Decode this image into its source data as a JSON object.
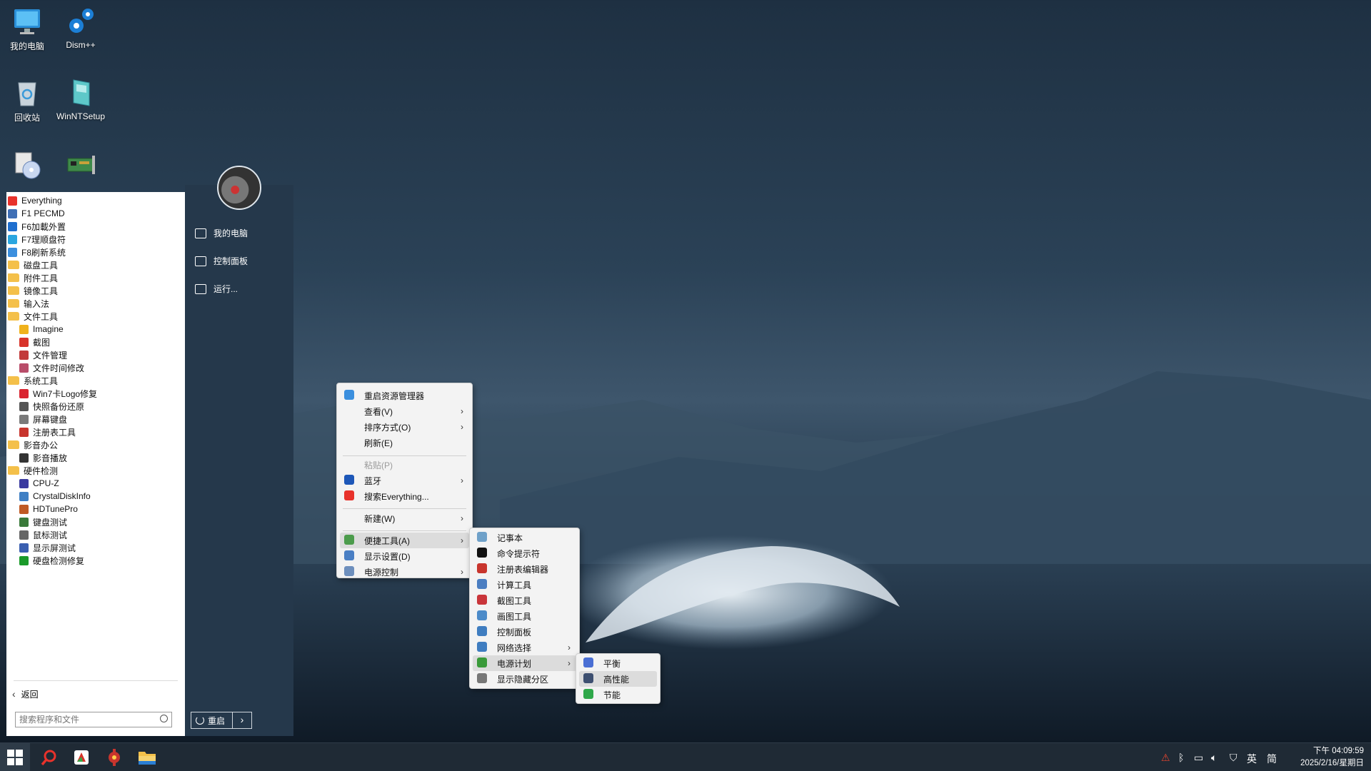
{
  "desktop": {
    "icons": [
      {
        "label": "我的电脑",
        "icon": "computer-icon"
      },
      {
        "label": "Dism++",
        "icon": "gears-icon"
      },
      {
        "label": "回收站",
        "icon": "recycle-bin-icon"
      },
      {
        "label": "WinNTSetup",
        "icon": "winntsetup-icon"
      },
      {
        "label": "",
        "icon": "installer-disc-icon"
      },
      {
        "label": "",
        "icon": "network-card-icon"
      }
    ]
  },
  "start_menu": {
    "items": [
      {
        "label": "Everything",
        "icon": "search-icon",
        "indent": false
      },
      {
        "label": "F1 PECMD",
        "icon": "pecmd-icon",
        "indent": false
      },
      {
        "label": "F6加載外置",
        "icon": "info-icon",
        "indent": false
      },
      {
        "label": "F7理顺盘符",
        "icon": "cube-icon",
        "indent": false
      },
      {
        "label": "F8刷新系统",
        "icon": "refresh-icon",
        "indent": false
      },
      {
        "label": "磁盘工具",
        "icon": "folder-icon",
        "indent": false
      },
      {
        "label": "附件工具",
        "icon": "folder-icon",
        "indent": false
      },
      {
        "label": "镜像工具",
        "icon": "folder-icon",
        "indent": false
      },
      {
        "label": "输入法",
        "icon": "folder-icon",
        "indent": false
      },
      {
        "label": "文件工具",
        "icon": "folder-icon",
        "indent": false
      },
      {
        "label": "Imagine",
        "icon": "imagine-icon",
        "indent": true
      },
      {
        "label": "截图",
        "icon": "screenshot-icon",
        "indent": true
      },
      {
        "label": "文件管理",
        "icon": "file-manager-icon",
        "indent": true
      },
      {
        "label": "文件时间修改",
        "icon": "file-time-icon",
        "indent": true
      },
      {
        "label": "系统工具",
        "icon": "folder-icon",
        "indent": false
      },
      {
        "label": "Win7卡Logo修复",
        "icon": "repair-icon",
        "indent": true
      },
      {
        "label": "快照备份还原",
        "icon": "snapshot-icon",
        "indent": true
      },
      {
        "label": "屏幕键盘",
        "icon": "keyboard-icon",
        "indent": true
      },
      {
        "label": "注册表工具",
        "icon": "registry-icon",
        "indent": true
      },
      {
        "label": "影音办公",
        "icon": "folder-icon",
        "indent": false
      },
      {
        "label": "影音播放",
        "icon": "media-player-icon",
        "indent": true
      },
      {
        "label": "硬件检测",
        "icon": "folder-icon",
        "indent": false
      },
      {
        "label": "CPU-Z",
        "icon": "cpu-icon",
        "indent": true
      },
      {
        "label": "CrystalDiskInfo",
        "icon": "disk-info-icon",
        "indent": true
      },
      {
        "label": "HDTunePro",
        "icon": "hdtune-icon",
        "indent": true
      },
      {
        "label": "键盘测试",
        "icon": "keyboard-test-icon",
        "indent": true
      },
      {
        "label": "鼠标测试",
        "icon": "mouse-test-icon",
        "indent": true
      },
      {
        "label": "显示屏测试",
        "icon": "monitor-test-icon",
        "indent": true
      },
      {
        "label": "硬盘检测修复",
        "icon": "disk-repair-icon",
        "indent": true
      }
    ],
    "back_label": "返回",
    "search_placeholder": "搜索程序和文件",
    "right_panel": {
      "items": [
        {
          "label": "我的电脑",
          "icon": "computer-icon"
        },
        {
          "label": "控制面板",
          "icon": "control-panel-icon"
        },
        {
          "label": "运行...",
          "icon": "run-icon"
        }
      ],
      "restart_label": "重启"
    }
  },
  "context_menu": {
    "items": [
      {
        "label": "重启资源管理器",
        "icon": "refresh-icon",
        "submenu": false,
        "disabled": false
      },
      {
        "label": "查看(V)",
        "icon": "",
        "submenu": true,
        "disabled": false
      },
      {
        "label": "排序方式(O)",
        "icon": "",
        "submenu": true,
        "disabled": false
      },
      {
        "label": "刷新(E)",
        "icon": "",
        "submenu": false,
        "disabled": false
      },
      {
        "label": "粘贴(P)",
        "icon": "",
        "submenu": false,
        "disabled": true
      },
      {
        "label": "蓝牙",
        "icon": "bluetooth-icon",
        "submenu": true,
        "disabled": false
      },
      {
        "label": "搜索Everything...",
        "icon": "search-icon",
        "submenu": false,
        "disabled": false
      },
      {
        "label": "新建(W)",
        "icon": "",
        "submenu": true,
        "disabled": false
      },
      {
        "label": "便捷工具(A)",
        "icon": "tools-icon",
        "submenu": true,
        "disabled": false
      },
      {
        "label": "显示设置(D)",
        "icon": "display-icon",
        "submenu": false,
        "disabled": false
      },
      {
        "label": "电源控制",
        "icon": "power-icon",
        "submenu": true,
        "disabled": false
      }
    ]
  },
  "tools_submenu": {
    "items": [
      {
        "label": "记事本",
        "icon": "notepad-icon",
        "submenu": false
      },
      {
        "label": "命令提示符",
        "icon": "cmd-icon",
        "submenu": false
      },
      {
        "label": "注册表编辑器",
        "icon": "registry-icon",
        "submenu": false
      },
      {
        "label": "计算工具",
        "icon": "calculator-icon",
        "submenu": false
      },
      {
        "label": "截图工具",
        "icon": "snip-icon",
        "submenu": false
      },
      {
        "label": "画图工具",
        "icon": "paint-icon",
        "submenu": false
      },
      {
        "label": "控制面板",
        "icon": "control-panel-icon",
        "submenu": false
      },
      {
        "label": "网络选择",
        "icon": "network-icon",
        "submenu": true
      },
      {
        "label": "电源计划",
        "icon": "power-plan-icon",
        "submenu": true
      },
      {
        "label": "显示隐藏分区",
        "icon": "partition-icon",
        "submenu": false
      }
    ]
  },
  "power_plan_submenu": {
    "items": [
      {
        "label": "平衡",
        "icon": "balance-icon"
      },
      {
        "label": "高性能",
        "icon": "high-performance-icon"
      },
      {
        "label": "节能",
        "icon": "power-saver-icon"
      }
    ]
  },
  "taskbar": {
    "apps": [
      "start-icon",
      "everything-icon",
      "screenshot-icon",
      "tools-icon",
      "file-explorer-icon"
    ],
    "tray": {
      "icons": [
        "network-warning-icon",
        "bluetooth-icon",
        "display-icon",
        "volume-icon",
        "security-icon"
      ],
      "ime_lang": "英",
      "ime_mode": "简",
      "time": "下午 04:09:59",
      "date": "2025/2/16/星期日"
    }
  }
}
